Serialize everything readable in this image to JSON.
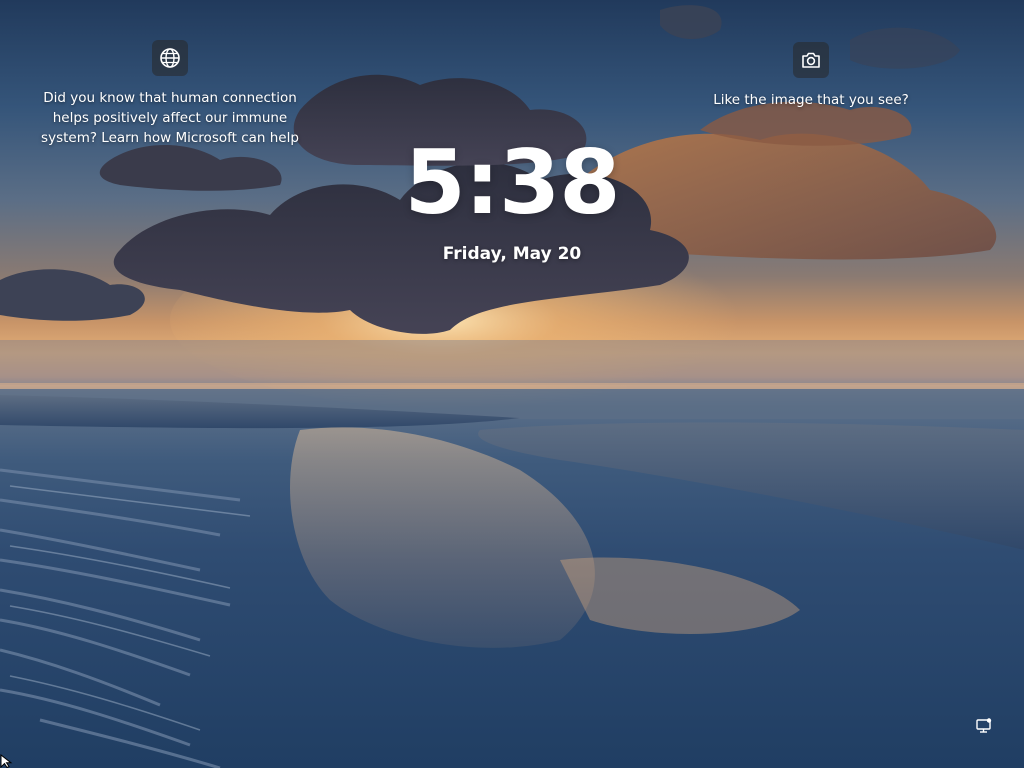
{
  "lock_screen": {
    "time": "5:38",
    "date": "Friday, May 20"
  },
  "spotlight": {
    "fact": {
      "icon": "globe-icon",
      "text": "Did you know that human connection helps positively affect our immune system? Learn how Microsoft can help"
    },
    "feedback": {
      "icon": "camera-icon",
      "text": "Like the image that you see?"
    }
  },
  "status": {
    "network_icon": "network-icon"
  },
  "colors": {
    "sky_top": "#213a5c",
    "horizon_glow": "#e2ae78",
    "water": "#2f4c72",
    "text": "#ffffff"
  }
}
